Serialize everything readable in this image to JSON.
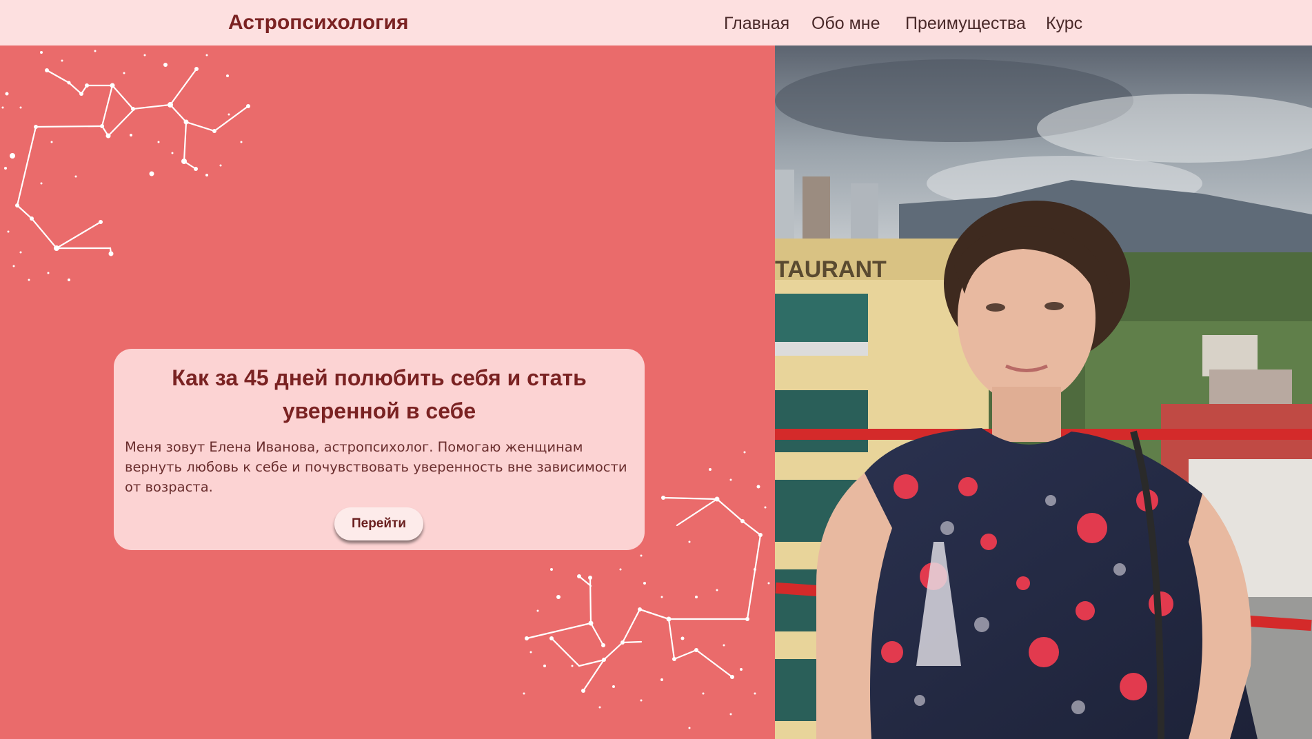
{
  "header": {
    "brand": "Астропсихология",
    "nav": [
      {
        "label": "Главная"
      },
      {
        "label": "Обо мне"
      },
      {
        "label": "Преимущества"
      },
      {
        "label": "Курс"
      }
    ]
  },
  "hero": {
    "title": "Как за 45 дней полюбить себя и стать уверенной в себе",
    "text": "Меня зовут Елена Иванова, астропсихолог. Помогаю женщинам вернуть любовь к себе и почувствовать уверенность вне зависимости от возраста.",
    "button_label": "Перейти"
  },
  "photo": {
    "sign_text": "TAURANT"
  },
  "colors": {
    "header_bg": "#fde0e0",
    "hero_bg": "#ea6b6b",
    "card_bg": "#fcd3d3",
    "accent_text": "#7a2222"
  }
}
